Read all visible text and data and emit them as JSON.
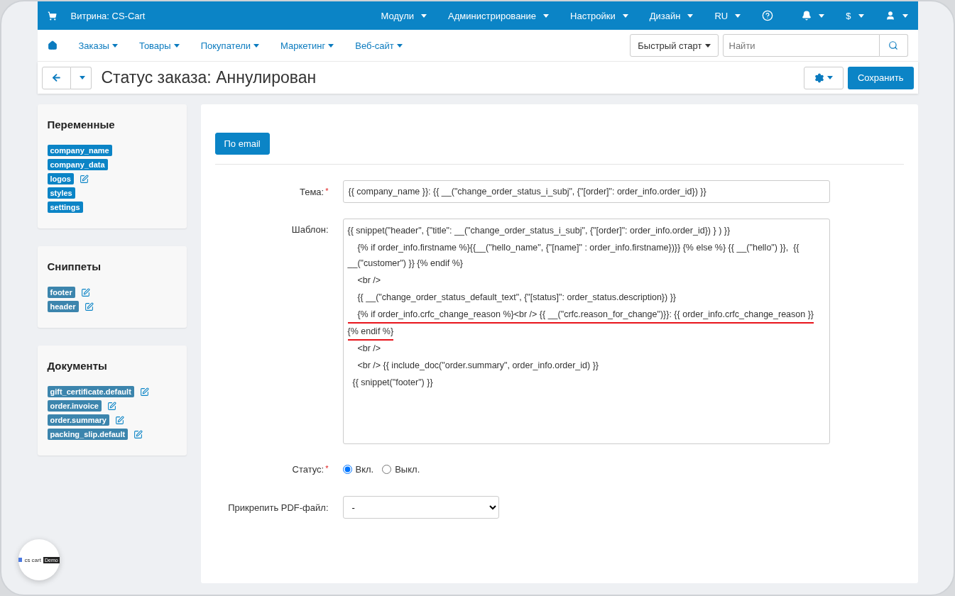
{
  "topbar": {
    "store": "Витрина: CS-Cart",
    "menus": [
      {
        "label": "Модули"
      },
      {
        "label": "Администрирование"
      },
      {
        "label": "Настройки"
      },
      {
        "label": "Дизайн"
      },
      {
        "label": "RU"
      }
    ],
    "currency": "$"
  },
  "nav": {
    "items": [
      {
        "label": "Заказы"
      },
      {
        "label": "Товары"
      },
      {
        "label": "Покупатели"
      },
      {
        "label": "Маркетинг"
      },
      {
        "label": "Веб-сайт"
      }
    ],
    "quick_start": "Быстрый старт",
    "search": {
      "placeholder": "Найти"
    }
  },
  "header": {
    "title": "Статус заказа: Аннулирован",
    "save": "Сохранить"
  },
  "sidebar": [
    {
      "title": "Переменные",
      "color": "#0b84c6",
      "items": [
        {
          "label": "company_name",
          "editable": false
        },
        {
          "label": "company_data",
          "editable": false
        },
        {
          "label": "logos",
          "editable": true
        },
        {
          "label": "styles",
          "editable": false
        },
        {
          "label": "settings",
          "editable": false
        }
      ]
    },
    {
      "title": "Сниппеты",
      "color": "#3c85ad",
      "items": [
        {
          "label": "footer",
          "editable": true
        },
        {
          "label": "header",
          "editable": true
        }
      ]
    },
    {
      "title": "Документы",
      "color": "#3c85ad",
      "items": [
        {
          "label": "gift_certificate.default",
          "editable": true
        },
        {
          "label": "order.invoice",
          "editable": true
        },
        {
          "label": "order.summary",
          "editable": true
        },
        {
          "label": "packing_slip.default",
          "editable": true
        }
      ]
    }
  ],
  "tab": {
    "label": "По email",
    "selected": true
  },
  "form": {
    "subject": {
      "label": "Тема:",
      "required_mark": "*",
      "value": "{{ company_name }}: {{ __(\"change_order_status_i_subj\", {\"[order]\": order_info.order_id}) }}"
    },
    "template": {
      "label": "Шаблон:",
      "lines": [
        {
          "text": "{{ snippet(\"header\", {\"title\": __(\"change_order_status_i_subj\", {\"[order]\": order_info.order_id}) } ) }}",
          "underlined": false
        },
        {
          "text": "    {% if order_info.firstname %}{{__(\"hello_name\", {\"[name]\" : order_info.firstname})}} {% else %} {{ __(\"hello\") }},  {{ __(\"customer\") }} {% endif %}",
          "underlined": false
        },
        {
          "text": "    <br />",
          "underlined": false
        },
        {
          "text": "    {{ __(\"change_order_status_default_text\", {\"[status]\": order_status.description}) }}",
          "underlined": false
        },
        {
          "text": "    {% if order_info.crfc_change_reason %}<br /> {{ __(\"crfc.reason_for_change\")}}: {{ order_info.crfc_change_reason }}",
          "underlined": true
        },
        {
          "text": "{% endif %}",
          "underlined": true
        },
        {
          "text": "    <br />",
          "underlined": false
        },
        {
          "text": "    <br /> {{ include_doc(\"order.summary\", order_info.order_id) }}",
          "underlined": false
        },
        {
          "text": "  {{ snippet(\"footer\") }}",
          "underlined": false
        }
      ]
    },
    "status": {
      "label": "Статус:",
      "required_mark": "*",
      "options": [
        {
          "label": "Вкл.",
          "selected": true
        },
        {
          "label": "Выкл.",
          "selected": false
        }
      ]
    },
    "pdf": {
      "label": "Прикрепить PDF-файл:",
      "value": "-"
    }
  },
  "logo": {
    "name": "cs cart",
    "badge": "Demo"
  }
}
